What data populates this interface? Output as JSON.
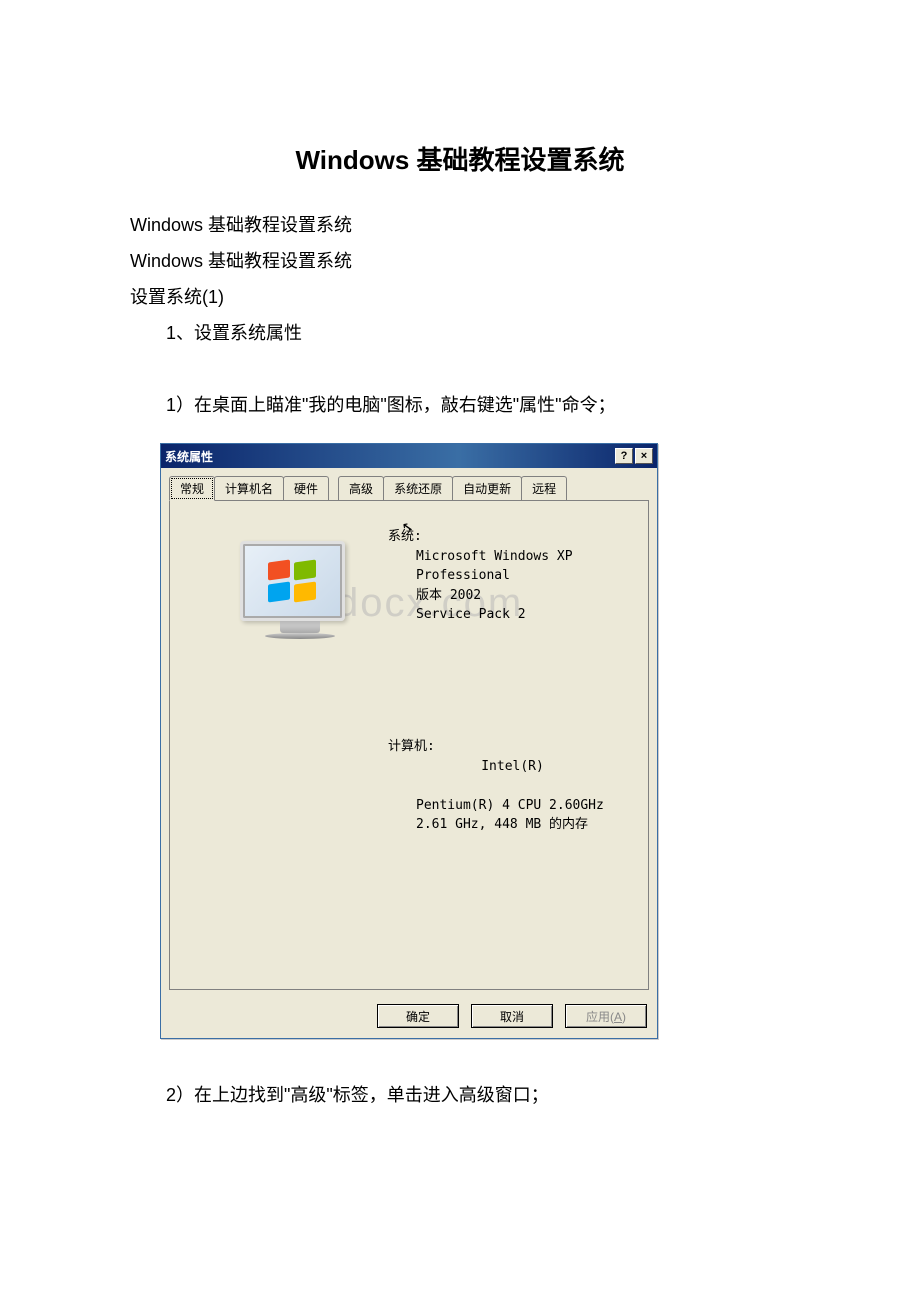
{
  "doc": {
    "title": "Windows 基础教程设置系统",
    "line1": "Windows 基础教程设置系统",
    "line2": "Windows 基础教程设置系统",
    "line3": "设置系统(1)",
    "step1_heading": "1、设置系统属性",
    "step1_body": "1）在桌面上瞄准\"我的电脑\"图标，敲右键选\"属性\"命令；",
    "step2_body": "2）在上边找到\"高级\"标签，单击进入高级窗口；"
  },
  "dialog": {
    "title": "系统属性",
    "help_btn": "?",
    "close_btn": "×",
    "tabs": {
      "t1": "常规",
      "t2": "计算机名",
      "t3": "硬件",
      "t4": "高级",
      "t5": "系统还原",
      "t6": "自动更新",
      "t7": "远程"
    },
    "system": {
      "label": "系统:",
      "l1": "Microsoft Windows XP",
      "l2": "Professional",
      "l3": "版本 2002",
      "l4": "Service Pack 2"
    },
    "computer": {
      "label": "计算机:",
      "l1": "Intel(R)",
      "l2": "Pentium(R) 4 CPU 2.60GHz",
      "l3": "2.61 GHz, 448 MB 的内存"
    },
    "buttons": {
      "ok": "确定",
      "cancel": "取消",
      "apply": "应用(A)"
    }
  },
  "watermark": "w.bdocx.com"
}
